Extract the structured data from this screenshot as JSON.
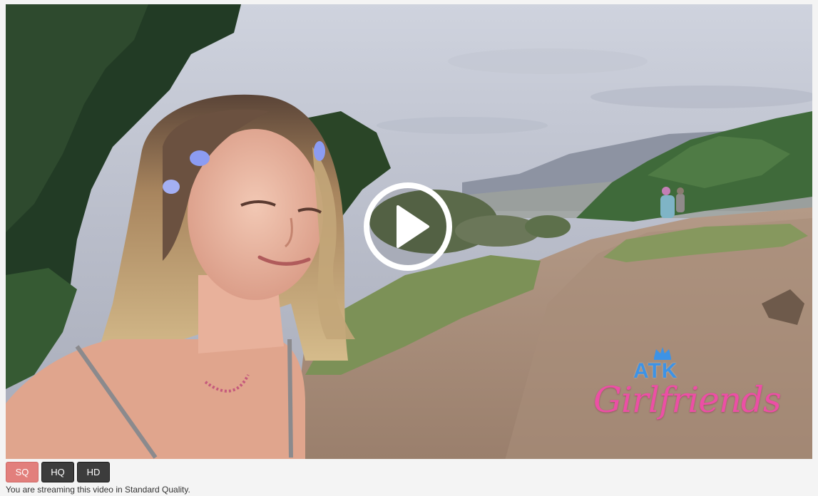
{
  "player": {
    "watermark": {
      "brand_top": "ATK",
      "brand_bottom": "Girlfriends"
    },
    "play_icon": "play-circle-icon"
  },
  "quality": {
    "options": [
      {
        "label": "SQ",
        "active": true
      },
      {
        "label": "HQ",
        "active": false
      },
      {
        "label": "HD",
        "active": false
      }
    ],
    "status": "You are streaming this video in Standard Quality."
  },
  "colors": {
    "active_quality": "#e27f7c",
    "inactive_quality": "#3c3c3c",
    "watermark_blue": "#3d93e6",
    "watermark_pink": "#ec4fa5"
  }
}
